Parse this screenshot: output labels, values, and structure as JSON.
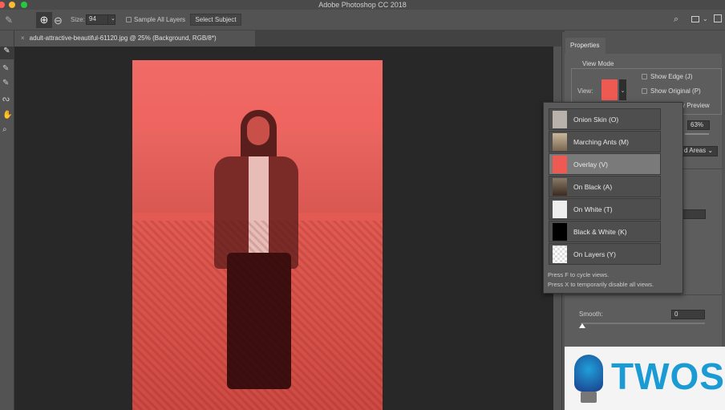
{
  "window": {
    "title": "Adobe Photoshop CC 2018"
  },
  "options": {
    "size_label": "Size:",
    "size_value": "94",
    "sample_all_layers": "Sample All Layers",
    "select_subject": "Select Subject"
  },
  "document": {
    "tab_title": "adult-attractive-beautiful-61120.jpg @ 25% (Background, RGB/8*)",
    "close": "×"
  },
  "properties": {
    "tab": "Properties",
    "view_mode": "View Mode",
    "view_label": "View:",
    "show_edge": "Show Edge (J)",
    "show_original": "Show Original (P)",
    "preview_partial": "y Preview",
    "opacity": "63%",
    "select_partial": "d Areas",
    "smooth_label": "Smooth:",
    "smooth_value": "0"
  },
  "view_menu": {
    "items": [
      {
        "label": "Onion Skin (O)",
        "thumb": "#b9b2aa"
      },
      {
        "label": "Marching Ants (M)",
        "thumb": "#8a7a66"
      },
      {
        "label": "Overlay (V)",
        "thumb": "#ee5a52",
        "selected": true
      },
      {
        "label": "On Black (A)",
        "thumb": "#6a5a48"
      },
      {
        "label": "On White (T)",
        "thumb": "#eeeeee"
      },
      {
        "label": "Black & White (K)",
        "thumb": "#000000"
      },
      {
        "label": "On Layers (Y)",
        "thumb": "#dddddd"
      }
    ],
    "hint1": "Press F to cycle views.",
    "hint2": "Press X to temporarily disable all views."
  },
  "logo": {
    "text": "TWOS"
  },
  "colors": {
    "overlay": "#ee625d",
    "canvas": "#282828",
    "panel": "#535353"
  }
}
